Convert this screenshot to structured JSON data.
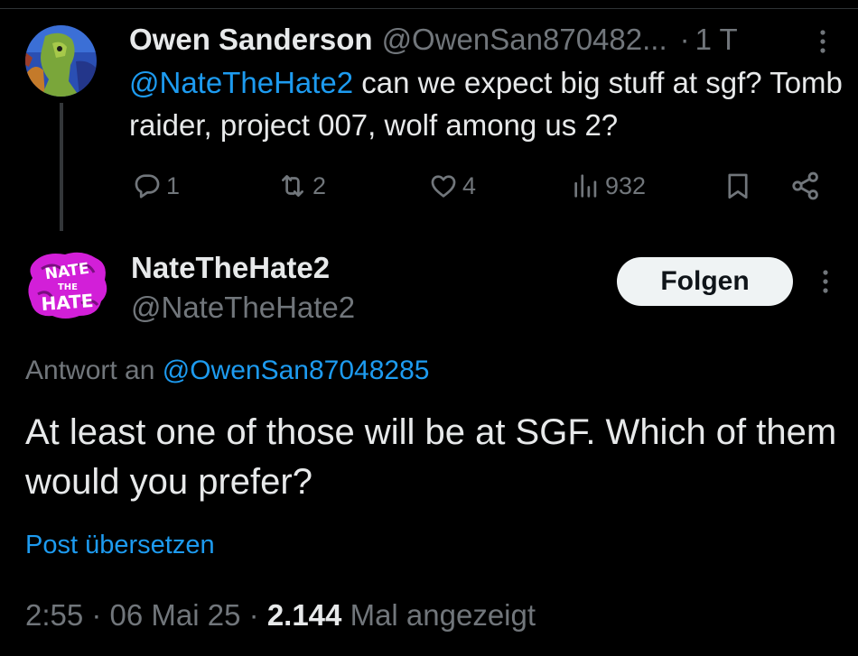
{
  "parent_tweet": {
    "author_name": "Owen Sanderson",
    "author_handle": "@OwenSan870482...",
    "separator": "·",
    "time": "1 T",
    "mention": "@NateTheHate2",
    "text": " can we expect big stuff at sgf? Tomb raider, project 007, wolf among us 2?",
    "avatar_icon": "painted-portrait-avatar",
    "actions": {
      "replies": "1",
      "reposts": "2",
      "likes": "4",
      "views": "932"
    }
  },
  "reply_tweet": {
    "author_name": "NateTheHate2",
    "author_handle": "@NateTheHate2",
    "avatar_icon": "nate-the-hate-logo",
    "avatar_text": "NATE THE HATE",
    "follow_label": "Folgen",
    "reply_to_label": "Antwort an",
    "reply_to_handle": "@OwenSan87048285",
    "text": "At least one of those will be at SGF. Which of them would you prefer?",
    "translate_label": "Post übersetzen",
    "timestamp": "2:55 · 06 Mai 25 ·",
    "view_count": "2.144",
    "view_label": "Mal angezeigt"
  },
  "colors": {
    "background": "#000000",
    "text_primary": "#e7e9ea",
    "text_secondary": "#71767b",
    "accent": "#1d9bf0",
    "follow_bg": "#eff3f4",
    "logo_magenta": "#d21fd8"
  }
}
